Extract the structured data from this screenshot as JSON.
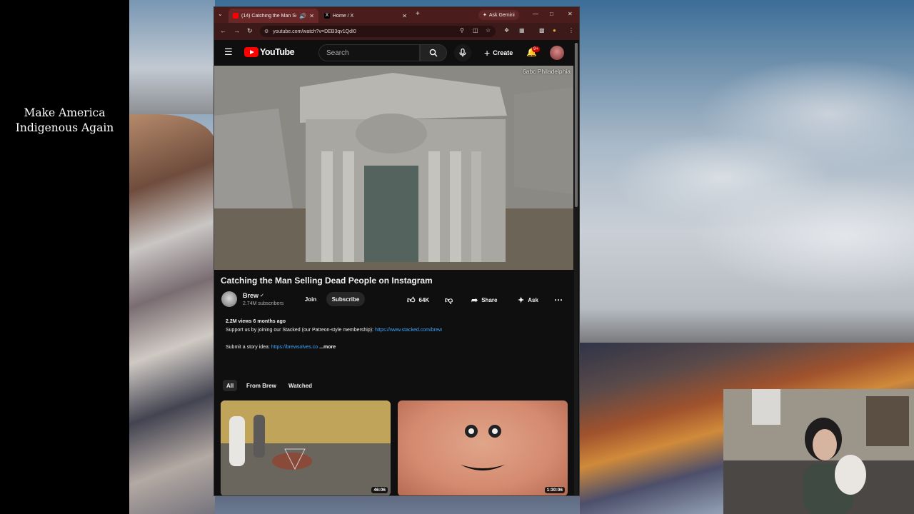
{
  "overlay": {
    "line1": "Make America",
    "line2": "Indigenous Again"
  },
  "browser": {
    "tabs": [
      {
        "label": "(14) Catching the Man Sell",
        "favicon_color": "#ff0000"
      },
      {
        "label": "Home / X",
        "favicon_color": "#000000"
      }
    ],
    "ask_gemini": "Ask Gemini",
    "url": "youtube.com/watch?v=DEB3qv1QdI0",
    "icons": {
      "tab_menu": "chevron-down-icon",
      "new_tab": "plus-icon",
      "back": "back-arrow-icon",
      "forward": "forward-arrow-icon",
      "reload": "reload-icon",
      "site_info": "site-info-icon",
      "zoom": "zoom-icon",
      "bookmark": "star-icon",
      "extensions": "puzzle-icon",
      "menu": "kebab-icon"
    }
  },
  "youtube": {
    "logo": "YouTube",
    "search_placeholder": "Search",
    "create_label": "Create",
    "notifications_badge": "9+",
    "video": {
      "watermark": "6abc Philadelphia",
      "title": "Catching the Man Selling Dead People on Instagram"
    },
    "channel": {
      "name": "Brew",
      "subscribers": "2.74M subscribers",
      "join_label": "Join",
      "subscribe_label": "Subscribe"
    },
    "actions": {
      "like_count": "64K",
      "share_label": "Share",
      "ask_label": "Ask"
    },
    "description": {
      "stats": "2.2M views  6 months ago",
      "support_text": "Support us by joining our Stacked (our Patreon-style membership): ",
      "support_link": "https://www.stacked.com/brew",
      "submit_text": "Submit a story idea: ",
      "submit_link": "https://brewsolves.co",
      "more_label": "...more"
    },
    "chips": [
      "All",
      "From Brew",
      "Watched"
    ],
    "related": [
      {
        "duration": "46:06"
      },
      {
        "duration": "1:30:06"
      }
    ]
  },
  "colors": {
    "accent": "#ff0000",
    "link": "#3ea6ff",
    "tabbar": "#4a1c1c"
  }
}
